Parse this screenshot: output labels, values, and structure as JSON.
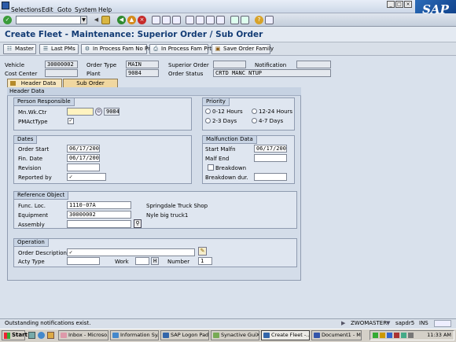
{
  "menu": {
    "selections": "Selections",
    "edit": "Edit",
    "goto": "Goto",
    "system": "System",
    "help": "Help"
  },
  "sap_logo": "SAP",
  "title": "Create Fleet - Maintenance: Superior Order / Sub Order",
  "app_toolbar": {
    "master": "Master",
    "last_pms": "Last PMs",
    "in_process_no_prt": "In Process Fam No Prt",
    "in_process_prt": "In Process Fam Prt",
    "save_order_family": "Save Order Family"
  },
  "header": {
    "vehicle_label": "Vehicle",
    "vehicle_value": "30000002",
    "order_type_label": "Order Type",
    "order_type_value": "MAIN",
    "superior_order_label": "Superior Order",
    "superior_order_value": "",
    "notification_label": "Notification",
    "notification_value": "",
    "cost_center_label": "Cost Center",
    "cost_center_value": "",
    "plant_label": "Plant",
    "plant_value": "9084",
    "order_status_label": "Order Status",
    "order_status_value": "CRTD MANC NTUP"
  },
  "tabs": {
    "header_data": "Header Data",
    "sub_order": "Sub Order"
  },
  "panel_title": "Header Data",
  "person_responsible": {
    "title": "Person Responsible",
    "mn_wk_ctr_label": "Mn.Wk.Ctr",
    "mn_wk_ctr_value": "",
    "plant_value": "9084",
    "pm_act_type_label": "PMActType",
    "pm_act_type_checked": "✓"
  },
  "priority": {
    "title": "Priority",
    "opt1": "0-12 Hours",
    "opt2": "12-24 Hours",
    "opt3": "2-3 Days",
    "opt4": "4-7 Days"
  },
  "dates": {
    "title": "Dates",
    "order_start_label": "Order Start",
    "order_start_value": "06/17/2005",
    "fin_date_label": "Fin. Date",
    "fin_date_value": "06/17/2005",
    "revision_label": "Revision",
    "revision_value": "",
    "reported_by_label": "Reported by",
    "reported_by_checked": "✓"
  },
  "malfunction": {
    "title": "Malfunction Data",
    "start_malfn_label": "Start Malfn",
    "start_malfn_value": "06/17/2005",
    "malf_end_label": "Malf End",
    "malf_end_value": "",
    "breakdown_label": "Breakdown",
    "breakdown_dur_label": "Breakdown dur.",
    "breakdown_dur_value": ""
  },
  "reference": {
    "title": "Reference Object",
    "func_loc_label": "Func. Loc.",
    "func_loc_value": "1110-07A",
    "func_loc_desc": "Springdale Truck Shop",
    "equipment_label": "Equipment",
    "equipment_value": "30000002",
    "equipment_desc": "Nyle big truck1",
    "assembly_label": "Assembly",
    "assembly_value": ""
  },
  "operation": {
    "title": "Operation",
    "order_desc_label": "Order Description",
    "order_desc_checked": "✓",
    "acty_type_label": "Acty Type",
    "acty_type_value": "",
    "work_label": "Work",
    "work_value": "",
    "work_unit": "H",
    "number_label": "Number",
    "number_value": "1"
  },
  "status": {
    "message": "Outstanding notifications exist.",
    "system": "ZWOMASTER",
    "server": "sapdr5",
    "mode": "INS"
  },
  "taskbar": {
    "start": "Start",
    "t1": "Inbox - Microso...",
    "t2": "Information Sy...",
    "t3": "SAP Logon Pad...",
    "t4": "Synactive GuiXT",
    "t5": "Create Fleet -...",
    "t6": "Document1 - Mi...",
    "clock": "11:33 AM"
  }
}
